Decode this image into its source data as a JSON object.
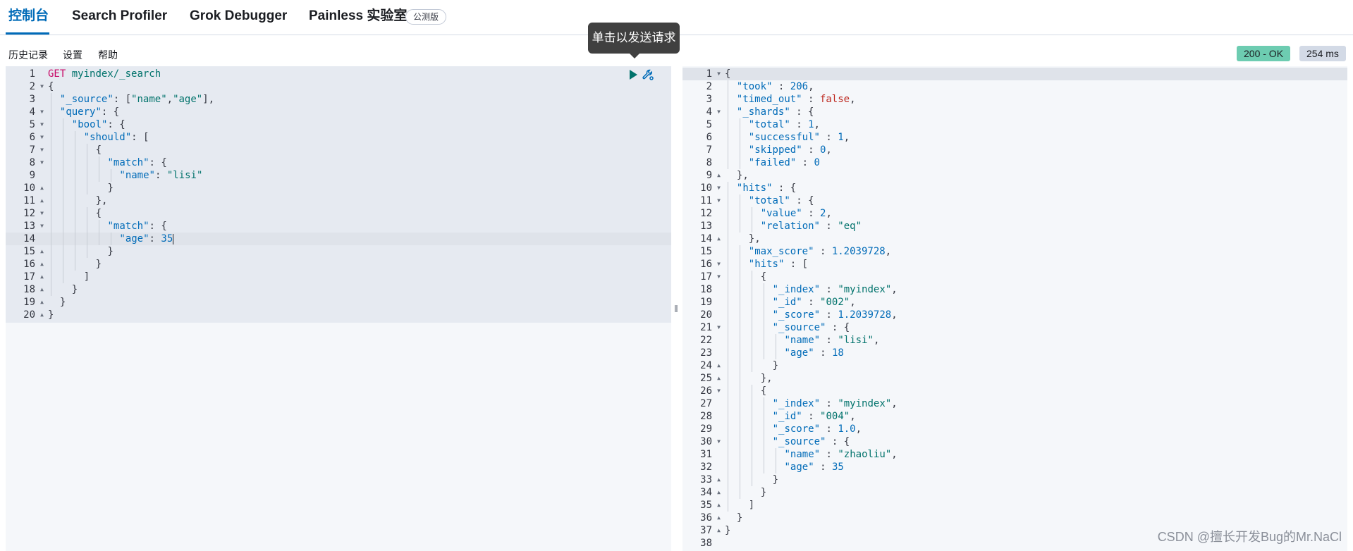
{
  "tabs": [
    {
      "label": "控制台",
      "selected": true
    },
    {
      "label": "Search Profiler"
    },
    {
      "label": "Grok Debugger"
    },
    {
      "label": "Painless 实验室"
    }
  ],
  "beta_badge": "公测版",
  "tooltip": "单击以发送请求",
  "toolbar": {
    "history": "历史记录",
    "settings": "设置",
    "help": "帮助"
  },
  "status": "200 - OK",
  "time": "254 ms",
  "icons": {
    "run": "play-icon",
    "actions": "wrench-icon",
    "resize": "resize-handle-icon"
  },
  "colors": {
    "accent": "#006bb8",
    "status_ok": "#6dccb1"
  },
  "request": {
    "active_line": 14,
    "lines": [
      {
        "n": "1",
        "fold": "",
        "indent": 0,
        "tokens": [
          [
            "method",
            "GET"
          ],
          [
            "punc",
            " "
          ],
          [
            "url",
            "myindex/_search"
          ]
        ]
      },
      {
        "n": "2",
        "fold": "▼",
        "indent": 0,
        "tokens": [
          [
            "punc",
            "{"
          ]
        ]
      },
      {
        "n": "3",
        "fold": "",
        "indent": 1,
        "tokens": [
          [
            "key",
            "\"_source\""
          ],
          [
            "punc",
            ": ["
          ],
          [
            "str",
            "\"name\""
          ],
          [
            "punc",
            ","
          ],
          [
            "str",
            "\"age\""
          ],
          [
            "punc",
            "],"
          ]
        ]
      },
      {
        "n": "4",
        "fold": "▼",
        "indent": 1,
        "tokens": [
          [
            "key",
            "\"query\""
          ],
          [
            "punc",
            ": {"
          ]
        ]
      },
      {
        "n": "5",
        "fold": "▼",
        "indent": 2,
        "tokens": [
          [
            "key",
            "\"bool\""
          ],
          [
            "punc",
            ": {"
          ]
        ]
      },
      {
        "n": "6",
        "fold": "▼",
        "indent": 3,
        "tokens": [
          [
            "key",
            "\"should\""
          ],
          [
            "punc",
            ": ["
          ]
        ]
      },
      {
        "n": "7",
        "fold": "▼",
        "indent": 4,
        "tokens": [
          [
            "punc",
            "{"
          ]
        ]
      },
      {
        "n": "8",
        "fold": "▼",
        "indent": 5,
        "tokens": [
          [
            "key",
            "\"match\""
          ],
          [
            "punc",
            ": {"
          ]
        ]
      },
      {
        "n": "9",
        "fold": "",
        "indent": 6,
        "tokens": [
          [
            "key",
            "\"name\""
          ],
          [
            "punc",
            ": "
          ],
          [
            "str",
            "\"lisi\""
          ]
        ]
      },
      {
        "n": "10",
        "fold": "▲",
        "indent": 5,
        "tokens": [
          [
            "punc",
            "}"
          ]
        ]
      },
      {
        "n": "11",
        "fold": "▲",
        "indent": 4,
        "tokens": [
          [
            "punc",
            "},"
          ]
        ]
      },
      {
        "n": "12",
        "fold": "▼",
        "indent": 4,
        "tokens": [
          [
            "punc",
            "{"
          ]
        ]
      },
      {
        "n": "13",
        "fold": "▼",
        "indent": 5,
        "tokens": [
          [
            "key",
            "\"match\""
          ],
          [
            "punc",
            ": {"
          ]
        ]
      },
      {
        "n": "14",
        "fold": "",
        "indent": 6,
        "tokens": [
          [
            "key",
            "\"age\""
          ],
          [
            "punc",
            ": "
          ],
          [
            "num",
            "35"
          ]
        ]
      },
      {
        "n": "15",
        "fold": "▲",
        "indent": 5,
        "tokens": [
          [
            "punc",
            "}"
          ]
        ]
      },
      {
        "n": "16",
        "fold": "▲",
        "indent": 4,
        "tokens": [
          [
            "punc",
            "}"
          ]
        ]
      },
      {
        "n": "17",
        "fold": "▲",
        "indent": 3,
        "tokens": [
          [
            "punc",
            "]"
          ]
        ]
      },
      {
        "n": "18",
        "fold": "▲",
        "indent": 2,
        "tokens": [
          [
            "punc",
            "}"
          ]
        ]
      },
      {
        "n": "19",
        "fold": "▲",
        "indent": 1,
        "tokens": [
          [
            "punc",
            "}"
          ]
        ]
      },
      {
        "n": "20",
        "fold": "▲",
        "indent": 0,
        "tokens": [
          [
            "punc",
            "}"
          ]
        ]
      }
    ]
  },
  "response": {
    "active_line": 1,
    "lines": [
      {
        "n": "1",
        "fold": "▼",
        "indent": 0,
        "tokens": [
          [
            "punc",
            "{"
          ]
        ]
      },
      {
        "n": "2",
        "fold": "",
        "indent": 1,
        "tokens": [
          [
            "key",
            "\"took\""
          ],
          [
            "punc",
            " : "
          ],
          [
            "num",
            "206"
          ],
          [
            "punc",
            ","
          ]
        ]
      },
      {
        "n": "3",
        "fold": "",
        "indent": 1,
        "tokens": [
          [
            "key",
            "\"timed_out\""
          ],
          [
            "punc",
            " : "
          ],
          [
            "bool",
            "false"
          ],
          [
            "punc",
            ","
          ]
        ]
      },
      {
        "n": "4",
        "fold": "▼",
        "indent": 1,
        "tokens": [
          [
            "key",
            "\"_shards\""
          ],
          [
            "punc",
            " : {"
          ]
        ]
      },
      {
        "n": "5",
        "fold": "",
        "indent": 2,
        "tokens": [
          [
            "key",
            "\"total\""
          ],
          [
            "punc",
            " : "
          ],
          [
            "num",
            "1"
          ],
          [
            "punc",
            ","
          ]
        ]
      },
      {
        "n": "6",
        "fold": "",
        "indent": 2,
        "tokens": [
          [
            "key",
            "\"successful\""
          ],
          [
            "punc",
            " : "
          ],
          [
            "num",
            "1"
          ],
          [
            "punc",
            ","
          ]
        ]
      },
      {
        "n": "7",
        "fold": "",
        "indent": 2,
        "tokens": [
          [
            "key",
            "\"skipped\""
          ],
          [
            "punc",
            " : "
          ],
          [
            "num",
            "0"
          ],
          [
            "punc",
            ","
          ]
        ]
      },
      {
        "n": "8",
        "fold": "",
        "indent": 2,
        "tokens": [
          [
            "key",
            "\"failed\""
          ],
          [
            "punc",
            " : "
          ],
          [
            "num",
            "0"
          ]
        ]
      },
      {
        "n": "9",
        "fold": "▲",
        "indent": 1,
        "tokens": [
          [
            "punc",
            "},"
          ]
        ]
      },
      {
        "n": "10",
        "fold": "▼",
        "indent": 1,
        "tokens": [
          [
            "key",
            "\"hits\""
          ],
          [
            "punc",
            " : {"
          ]
        ]
      },
      {
        "n": "11",
        "fold": "▼",
        "indent": 2,
        "tokens": [
          [
            "key",
            "\"total\""
          ],
          [
            "punc",
            " : {"
          ]
        ]
      },
      {
        "n": "12",
        "fold": "",
        "indent": 3,
        "tokens": [
          [
            "key",
            "\"value\""
          ],
          [
            "punc",
            " : "
          ],
          [
            "num",
            "2"
          ],
          [
            "punc",
            ","
          ]
        ]
      },
      {
        "n": "13",
        "fold": "",
        "indent": 3,
        "tokens": [
          [
            "key",
            "\"relation\""
          ],
          [
            "punc",
            " : "
          ],
          [
            "str",
            "\"eq\""
          ]
        ]
      },
      {
        "n": "14",
        "fold": "▲",
        "indent": 2,
        "tokens": [
          [
            "punc",
            "},"
          ]
        ]
      },
      {
        "n": "15",
        "fold": "",
        "indent": 2,
        "tokens": [
          [
            "key",
            "\"max_score\""
          ],
          [
            "punc",
            " : "
          ],
          [
            "num",
            "1.2039728"
          ],
          [
            "punc",
            ","
          ]
        ]
      },
      {
        "n": "16",
        "fold": "▼",
        "indent": 2,
        "tokens": [
          [
            "key",
            "\"hits\""
          ],
          [
            "punc",
            " : ["
          ]
        ]
      },
      {
        "n": "17",
        "fold": "▼",
        "indent": 3,
        "tokens": [
          [
            "punc",
            "{"
          ]
        ]
      },
      {
        "n": "18",
        "fold": "",
        "indent": 4,
        "tokens": [
          [
            "key",
            "\"_index\""
          ],
          [
            "punc",
            " : "
          ],
          [
            "str",
            "\"myindex\""
          ],
          [
            "punc",
            ","
          ]
        ]
      },
      {
        "n": "19",
        "fold": "",
        "indent": 4,
        "tokens": [
          [
            "key",
            "\"_id\""
          ],
          [
            "punc",
            " : "
          ],
          [
            "str",
            "\"002\""
          ],
          [
            "punc",
            ","
          ]
        ]
      },
      {
        "n": "20",
        "fold": "",
        "indent": 4,
        "tokens": [
          [
            "key",
            "\"_score\""
          ],
          [
            "punc",
            " : "
          ],
          [
            "num",
            "1.2039728"
          ],
          [
            "punc",
            ","
          ]
        ]
      },
      {
        "n": "21",
        "fold": "▼",
        "indent": 4,
        "tokens": [
          [
            "key",
            "\"_source\""
          ],
          [
            "punc",
            " : {"
          ]
        ]
      },
      {
        "n": "22",
        "fold": "",
        "indent": 5,
        "tokens": [
          [
            "key",
            "\"name\""
          ],
          [
            "punc",
            " : "
          ],
          [
            "str",
            "\"lisi\""
          ],
          [
            "punc",
            ","
          ]
        ]
      },
      {
        "n": "23",
        "fold": "",
        "indent": 5,
        "tokens": [
          [
            "key",
            "\"age\""
          ],
          [
            "punc",
            " : "
          ],
          [
            "num",
            "18"
          ]
        ]
      },
      {
        "n": "24",
        "fold": "▲",
        "indent": 4,
        "tokens": [
          [
            "punc",
            "}"
          ]
        ]
      },
      {
        "n": "25",
        "fold": "▲",
        "indent": 3,
        "tokens": [
          [
            "punc",
            "},"
          ]
        ]
      },
      {
        "n": "26",
        "fold": "▼",
        "indent": 3,
        "tokens": [
          [
            "punc",
            "{"
          ]
        ]
      },
      {
        "n": "27",
        "fold": "",
        "indent": 4,
        "tokens": [
          [
            "key",
            "\"_index\""
          ],
          [
            "punc",
            " : "
          ],
          [
            "str",
            "\"myindex\""
          ],
          [
            "punc",
            ","
          ]
        ]
      },
      {
        "n": "28",
        "fold": "",
        "indent": 4,
        "tokens": [
          [
            "key",
            "\"_id\""
          ],
          [
            "punc",
            " : "
          ],
          [
            "str",
            "\"004\""
          ],
          [
            "punc",
            ","
          ]
        ]
      },
      {
        "n": "29",
        "fold": "",
        "indent": 4,
        "tokens": [
          [
            "key",
            "\"_score\""
          ],
          [
            "punc",
            " : "
          ],
          [
            "num",
            "1.0"
          ],
          [
            "punc",
            ","
          ]
        ]
      },
      {
        "n": "30",
        "fold": "▼",
        "indent": 4,
        "tokens": [
          [
            "key",
            "\"_source\""
          ],
          [
            "punc",
            " : {"
          ]
        ]
      },
      {
        "n": "31",
        "fold": "",
        "indent": 5,
        "tokens": [
          [
            "key",
            "\"name\""
          ],
          [
            "punc",
            " : "
          ],
          [
            "str",
            "\"zhaoliu\""
          ],
          [
            "punc",
            ","
          ]
        ]
      },
      {
        "n": "32",
        "fold": "",
        "indent": 5,
        "tokens": [
          [
            "key",
            "\"age\""
          ],
          [
            "punc",
            " : "
          ],
          [
            "num",
            "35"
          ]
        ]
      },
      {
        "n": "33",
        "fold": "▲",
        "indent": 4,
        "tokens": [
          [
            "punc",
            "}"
          ]
        ]
      },
      {
        "n": "34",
        "fold": "▲",
        "indent": 3,
        "tokens": [
          [
            "punc",
            "}"
          ]
        ]
      },
      {
        "n": "35",
        "fold": "▲",
        "indent": 2,
        "tokens": [
          [
            "punc",
            "]"
          ]
        ]
      },
      {
        "n": "36",
        "fold": "▲",
        "indent": 1,
        "tokens": [
          [
            "punc",
            "}"
          ]
        ]
      },
      {
        "n": "37",
        "fold": "▲",
        "indent": 0,
        "tokens": [
          [
            "punc",
            "}"
          ]
        ]
      },
      {
        "n": "38",
        "fold": "",
        "indent": 0,
        "tokens": []
      }
    ]
  },
  "watermark": "CSDN @擅长开发Bug的Mr.NaCl"
}
